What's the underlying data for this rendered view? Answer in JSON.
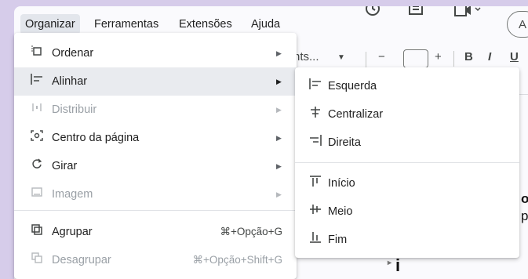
{
  "menubar": {
    "items": [
      {
        "label": "Organizar",
        "active": true
      },
      {
        "label": "Ferramentas"
      },
      {
        "label": "Extensões"
      },
      {
        "label": "Ajuda"
      }
    ]
  },
  "top_icons": {
    "history": "history-icon",
    "comments": "comment-icon",
    "meet": "video-icon",
    "share_initial": "A"
  },
  "toolbar": {
    "font_name": "nts...",
    "minus": "−",
    "plus": "+",
    "bold": "B",
    "italic": "I",
    "underline": "U"
  },
  "doc": {
    "frag1": "o",
    "frag2": "p",
    "frag3": "i"
  },
  "menu": {
    "items": [
      {
        "label": "Ordenar",
        "icon": "order-icon",
        "submenu": true,
        "disabled": false
      },
      {
        "label": "Alinhar",
        "icon": "align-icon",
        "submenu": true,
        "disabled": false,
        "highlighted": true
      },
      {
        "label": "Distribuir",
        "icon": "distribute-icon",
        "submenu": true,
        "disabled": true
      },
      {
        "label": "Centro da página",
        "icon": "center-page-icon",
        "submenu": true,
        "disabled": false
      },
      {
        "label": "Girar",
        "icon": "rotate-icon",
        "submenu": true,
        "disabled": false
      },
      {
        "label": "Imagem",
        "icon": "image-icon",
        "submenu": true,
        "disabled": true
      },
      {
        "label": "Agrupar",
        "icon": "group-icon",
        "shortcut": "⌘+Opção+G",
        "disabled": false
      },
      {
        "label": "Desagrupar",
        "icon": "ungroup-icon",
        "shortcut": "⌘+Opção+Shift+G",
        "disabled": true
      }
    ]
  },
  "submenu": {
    "items": [
      {
        "label": "Esquerda",
        "icon": "align-left-icon"
      },
      {
        "label": "Centralizar",
        "icon": "align-center-icon"
      },
      {
        "label": "Direita",
        "icon": "align-right-icon"
      },
      {
        "label": "Início",
        "icon": "align-top-icon"
      },
      {
        "label": "Meio",
        "icon": "align-middle-icon"
      },
      {
        "label": "Fim",
        "icon": "align-bottom-icon"
      }
    ]
  }
}
